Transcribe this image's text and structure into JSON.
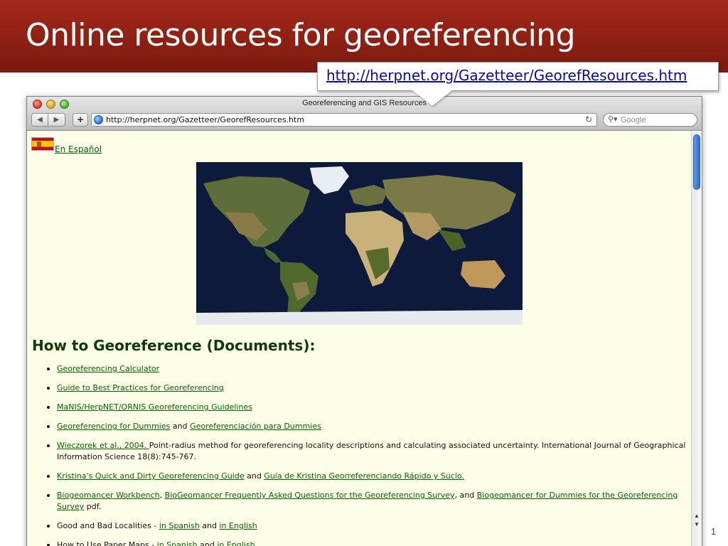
{
  "slide": {
    "title": "Online resources for georeferencing",
    "callout_url": "http://herpnet.org/Gazetteer/GeorefResources.htm",
    "page_number": "1"
  },
  "browser": {
    "window_title": "Georeferencing and GIS Resources",
    "address": "http://herpnet.org/Gazetteer/GeorefResources.htm",
    "search_placeholder": "Google",
    "icons": {
      "back": "back-arrow-icon",
      "forward": "forward-arrow-icon",
      "add": "plus-icon",
      "site": "globe-icon",
      "reload": "reload-icon",
      "search": "search-icon"
    }
  },
  "page": {
    "language_link": "En Español",
    "heading": "How to Georeference (Documents):",
    "items": [
      {
        "parts": [
          {
            "text": "Georeferencing Calculator",
            "link": true
          }
        ]
      },
      {
        "parts": [
          {
            "text": "Guide to Best Practices for Georeferencing",
            "link": true
          }
        ]
      },
      {
        "parts": [
          {
            "text": "MaNIS/HerpNET/ORNIS Georeferencing Guidelines",
            "link": true
          }
        ]
      },
      {
        "parts": [
          {
            "text": "Georeferencing for Dummies",
            "link": true
          },
          {
            "text": " and ",
            "link": false
          },
          {
            "text": "Georeferenciación para Dummies",
            "link": true
          }
        ]
      },
      {
        "parts": [
          {
            "text": "Wieczorek et al., 2004. ",
            "link": true
          },
          {
            "text": "Point-radius method for georeferencing locality descriptions and calculating associated uncertainty. International Journal of Geographical Information Science 18(8):745-767.",
            "link": false
          }
        ]
      },
      {
        "parts": [
          {
            "text": "Kristina's Quick and Dirty Georeferencing Guide",
            "link": true
          },
          {
            "text": " and ",
            "link": false
          },
          {
            "text": "Guía de Kristina Georreferenciando Rápido y Sucio.",
            "link": true
          }
        ]
      },
      {
        "parts": [
          {
            "text": "Biogeomancer Workbench",
            "link": true
          },
          {
            "text": ", ",
            "link": false
          },
          {
            "text": "BioGeomancer Frequently Asked Questions for the Georeferencing Survey",
            "link": true
          },
          {
            "text": ", and ",
            "link": false
          },
          {
            "text": "Biogeomancer for Dummies for the Georeferencing Survey",
            "link": true
          },
          {
            "text": " pdf.",
            "link": false
          }
        ]
      },
      {
        "parts": [
          {
            "text": "Good and Bad Localities - ",
            "link": false
          },
          {
            "text": "in Spanish",
            "link": true
          },
          {
            "text": " and ",
            "link": false
          },
          {
            "text": "in English",
            "link": true
          }
        ]
      },
      {
        "parts": [
          {
            "text": "How to Use Paper Maps - ",
            "link": false
          },
          {
            "text": "in Spanish",
            "link": true
          },
          {
            "text": " and ",
            "link": false
          },
          {
            "text": "in English",
            "link": true
          }
        ]
      }
    ]
  },
  "colors": {
    "header_red": "#8c1f13",
    "link_green": "#006600",
    "page_bg": "#fdfde8",
    "heading_green": "#0f3a0a"
  }
}
